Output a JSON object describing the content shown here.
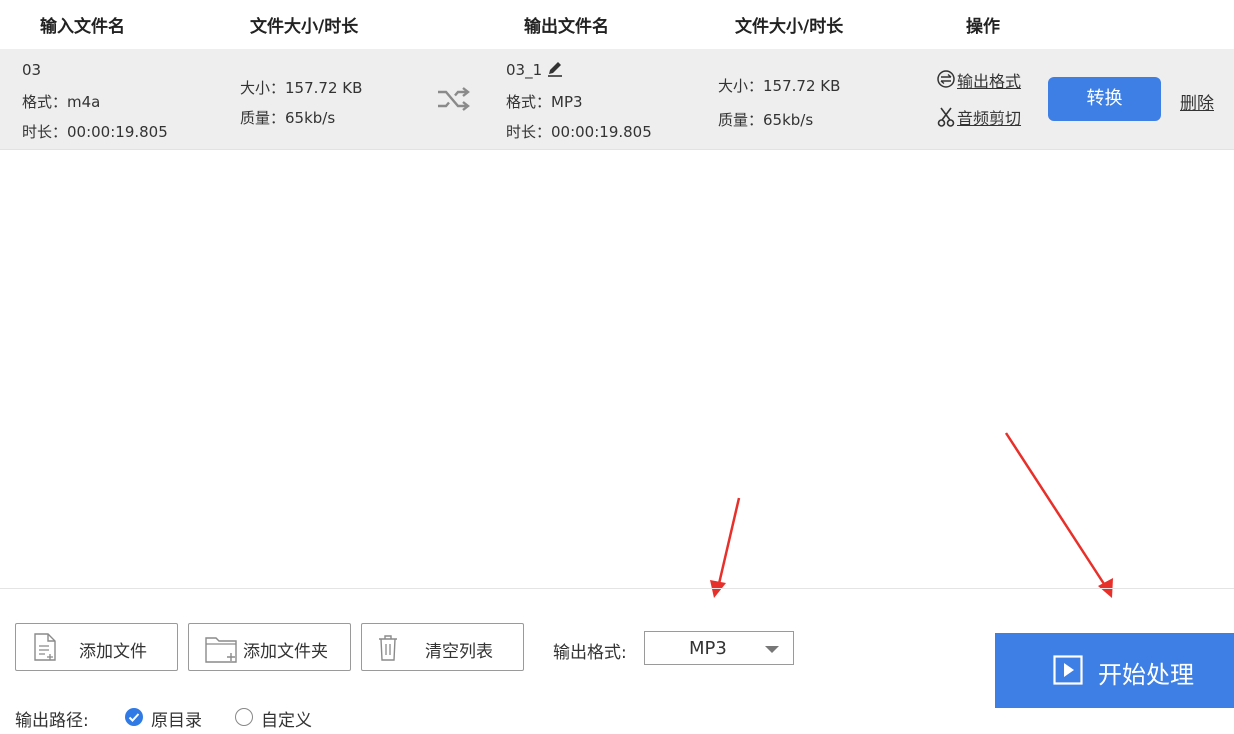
{
  "header": {
    "input_name": "输入文件名",
    "input_size": "文件大小/时长",
    "output_name": "输出文件名",
    "output_size": "文件大小/时长",
    "actions": "操作"
  },
  "file_row": {
    "input": {
      "name": "03",
      "format": "格式：m4a",
      "duration": "时长：00:00:19.805",
      "size": "大小：157.72 KB",
      "quality": "质量：65kb/s"
    },
    "output": {
      "name": "03_1",
      "format": "格式：MP3",
      "duration": "时长：00:00:19.805",
      "size": "大小：157.72 KB",
      "quality": "质量：65kb/s"
    },
    "actions": {
      "output_format": "输出格式",
      "audio_cut": "音频剪切",
      "convert": "转换",
      "delete": "删除"
    }
  },
  "toolbar": {
    "add_file": "添加文件",
    "add_folder": "添加文件夹",
    "clear_list": "清空列表",
    "output_format_label": "输出格式:",
    "output_format_value": "MP3",
    "start": "开始处理"
  },
  "output_path": {
    "label": "输出路径:",
    "options": [
      {
        "label": "原目录",
        "selected": true
      },
      {
        "label": "自定义",
        "selected": false
      }
    ]
  },
  "colors": {
    "accent": "#3e7fe6",
    "row_bg": "#eeeeee",
    "annotation_arrow": "#e8302a"
  }
}
